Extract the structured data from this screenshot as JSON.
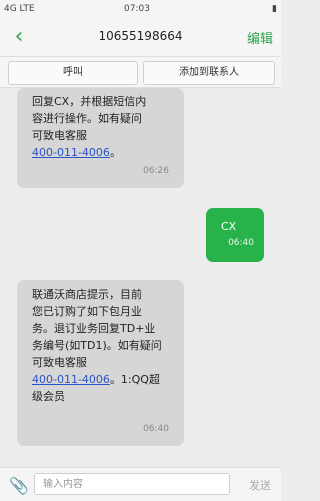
{
  "status_bar": {
    "signal_text": "4G LTE",
    "time": "07:03",
    "battery": "▮"
  },
  "header": {
    "title": "10655198664",
    "edit_label": "编辑"
  },
  "actions": {
    "call_label": "呼叫",
    "add_contact_label": "添加到联系人"
  },
  "messages": [
    {
      "direction": "incoming",
      "text": "回复CX，并根据短信内\n容进行操作。如有疑问\n可致电客服",
      "phone": "400-011-4006",
      "suffix": "。",
      "time": "06:26"
    },
    {
      "direction": "outgoing",
      "text": "CX",
      "time": "06:40"
    },
    {
      "direction": "incoming",
      "text": "联通沃商店提示，目前\n您已订购了如下包月业\n务。退订业务回复TD+业\n务编号(如TD1)。如有疑问\n可致电客服",
      "phone": "400-011-4006",
      "suffix": "。1:QQ超\n级会员",
      "time": "06:40"
    }
  ],
  "composer": {
    "placeholder": "输入内容",
    "send_label": "发送"
  }
}
